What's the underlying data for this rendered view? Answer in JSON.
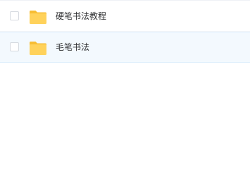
{
  "colors": {
    "folder": "#ffd25b",
    "folder_tab": "#f7bd34",
    "selected_row_bg": "#f3f9fe",
    "text": "#303133"
  },
  "files": [
    {
      "name": "硬笔书法教程",
      "type": "folder",
      "icon": "folder-icon",
      "selected": false,
      "checked": false
    },
    {
      "name": "毛笔书法",
      "type": "folder",
      "icon": "folder-icon",
      "selected": true,
      "checked": false
    }
  ]
}
